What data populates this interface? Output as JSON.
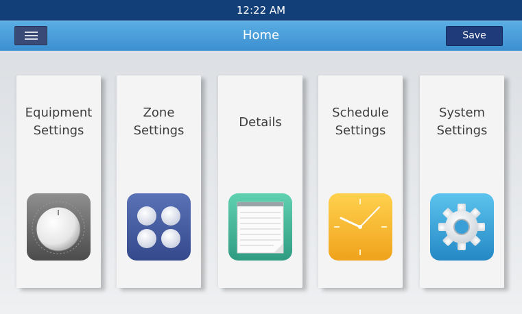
{
  "status_bar": {
    "time": "12:22 AM"
  },
  "header": {
    "title": "Home",
    "save_label": "Save"
  },
  "tiles": [
    {
      "label": "Equipment\nSettings",
      "icon": "thermostat-knob-icon"
    },
    {
      "label": "Zone\nSettings",
      "icon": "zones-grid-icon"
    },
    {
      "label": "Details",
      "icon": "notepad-icon"
    },
    {
      "label": "Schedule\nSettings",
      "icon": "clock-icon"
    },
    {
      "label": "System\nSettings",
      "icon": "gear-icon"
    }
  ],
  "colors": {
    "status_bar": "#123f77",
    "app_bar": "#4a9ed9",
    "save_button": "#1f3b7a",
    "menu_button": "#3a4a76"
  }
}
